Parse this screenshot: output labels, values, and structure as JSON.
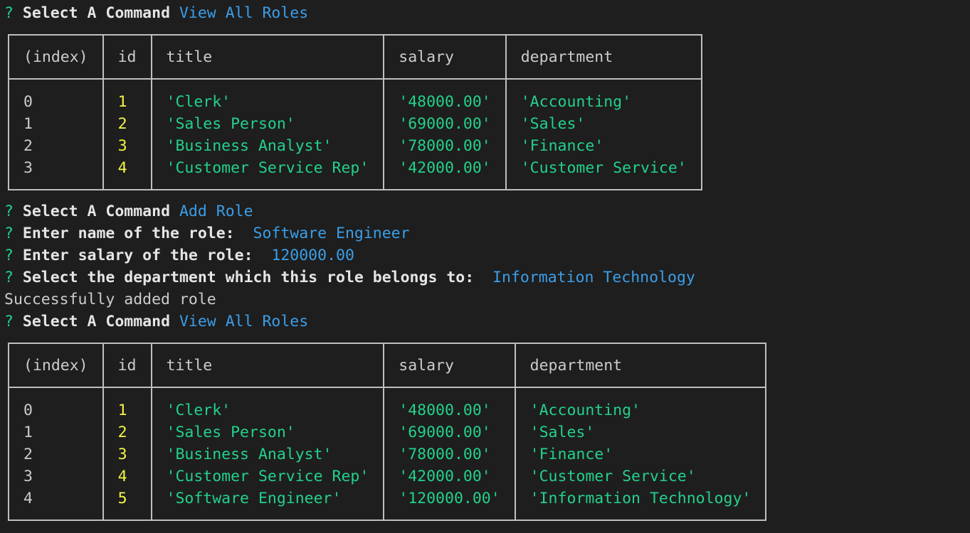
{
  "prompt_symbol": "?",
  "session": {
    "cmd1": {
      "label": "Select A Command",
      "answer": "View All Roles"
    },
    "cmd2": {
      "label": "Select A Command",
      "answer": "Add Role"
    },
    "q_name": {
      "label": "Enter name of the role:",
      "answer": "Software Engineer"
    },
    "q_salary": {
      "label": "Enter salary of the role:",
      "answer": "120000.00"
    },
    "q_dept": {
      "label": "Select the department which this role belongs to:",
      "answer": "Information Technology"
    },
    "success_message": "Successfully added role",
    "cmd3": {
      "label": "Select A Command",
      "answer": "View All Roles"
    }
  },
  "table_headers": [
    "(index)",
    "id",
    "title",
    "salary",
    "department"
  ],
  "table1_rows": [
    [
      "0",
      "1",
      "'Clerk'",
      "'48000.00'",
      "'Accounting'"
    ],
    [
      "1",
      "2",
      "'Sales Person'",
      "'69000.00'",
      "'Sales'"
    ],
    [
      "2",
      "3",
      "'Business Analyst'",
      "'78000.00'",
      "'Finance'"
    ],
    [
      "3",
      "4",
      "'Customer Service Rep'",
      "'42000.00'",
      "'Customer Service'"
    ]
  ],
  "table2_rows": [
    [
      "0",
      "1",
      "'Clerk'",
      "'48000.00'",
      "'Accounting'"
    ],
    [
      "1",
      "2",
      "'Sales Person'",
      "'69000.00'",
      "'Sales'"
    ],
    [
      "2",
      "3",
      "'Business Analyst'",
      "'78000.00'",
      "'Finance'"
    ],
    [
      "3",
      "4",
      "'Customer Service Rep'",
      "'42000.00'",
      "'Customer Service'"
    ],
    [
      "4",
      "5",
      "'Software Engineer'",
      "'120000.00'",
      "'Information Technology'"
    ]
  ],
  "colors": {
    "background": "#1e1e1e",
    "prompt_green": "#23d18b",
    "answer_blue": "#3b9ee8",
    "id_yellow": "#f5f543",
    "string_green": "#23d18b"
  }
}
